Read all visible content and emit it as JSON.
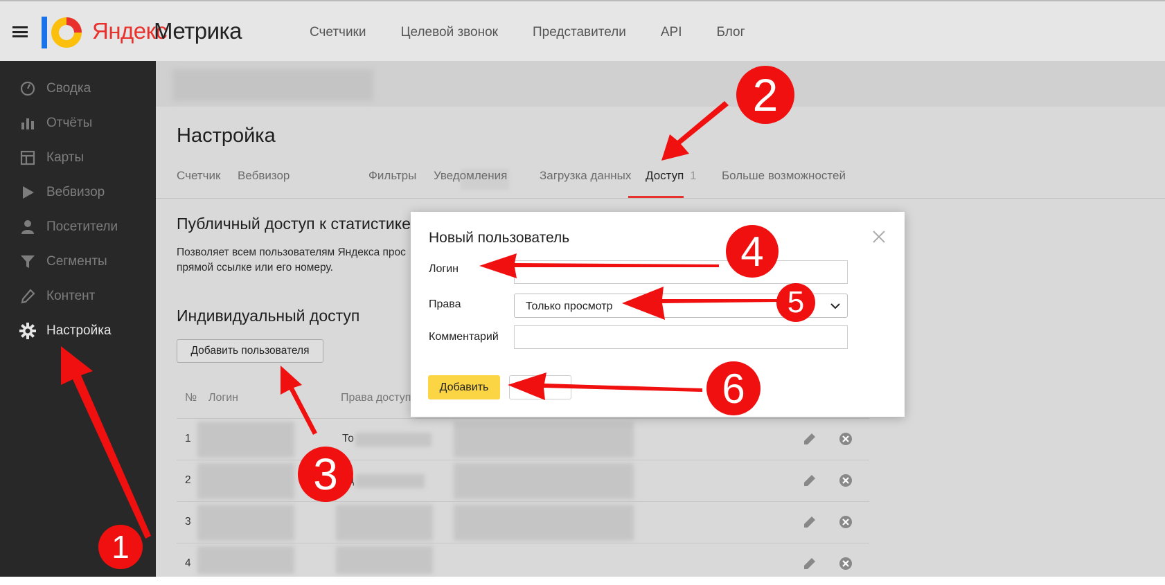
{
  "header": {
    "brand_yandex": "Яндекс",
    "brand_metrika": "Метрика",
    "nav": [
      "Счетчики",
      "Целевой звонок",
      "Представители",
      "API",
      "Блог"
    ]
  },
  "sidebar": {
    "items": [
      {
        "label": "Сводка",
        "icon": "gauge-icon"
      },
      {
        "label": "Отчёты",
        "icon": "bar-chart-icon"
      },
      {
        "label": "Карты",
        "icon": "map-layout-icon"
      },
      {
        "label": "Вебвизор",
        "icon": "play-icon"
      },
      {
        "label": "Посетители",
        "icon": "person-icon"
      },
      {
        "label": "Сегменты",
        "icon": "funnel-icon"
      },
      {
        "label": "Контент",
        "icon": "pencil-icon"
      },
      {
        "label": "Настройка",
        "icon": "gear-icon",
        "active": true
      }
    ]
  },
  "main": {
    "title": "Настройка",
    "tabs": [
      {
        "label": "Счетчик"
      },
      {
        "label": "Вебвизор"
      },
      {
        "label": "Фильтры"
      },
      {
        "label": "Уведомления"
      },
      {
        "label": "Загрузка данных"
      },
      {
        "label": "Доступ",
        "active": true,
        "count": "1"
      },
      {
        "label": "Больше возможностей"
      }
    ],
    "public_access_title": "Публичный доступ к статистике",
    "public_access_desc_line1": "Позволяет всем пользователям Яндекса прос",
    "public_access_desc_line2": "прямой ссылке или его номеру.",
    "individual_access_title": "Индивидуальный доступ",
    "add_user_label": "Добавить пользователя",
    "table": {
      "headers": [
        "№",
        "Логин",
        "Права доступ"
      ],
      "rows": [
        {
          "num": "1",
          "rights": "То"
        },
        {
          "num": "2",
          "rights": "ед"
        },
        {
          "num": "3",
          "rights": ""
        },
        {
          "num": "4",
          "rights": ""
        }
      ]
    }
  },
  "modal": {
    "title": "Новый пользователь",
    "login_label": "Логин",
    "login_value": "",
    "rights_label": "Права",
    "rights_value": "Только просмотр",
    "comment_label": "Комментарий",
    "comment_value": "",
    "submit_label": "Добавить"
  },
  "annotations": [
    "1",
    "2",
    "3",
    "4",
    "5",
    "6"
  ],
  "colors": {
    "accent_red": "#e8312c",
    "annotation_red": "#f01010",
    "submit_yellow": "#fbd544",
    "sidebar_bg": "#282828"
  }
}
